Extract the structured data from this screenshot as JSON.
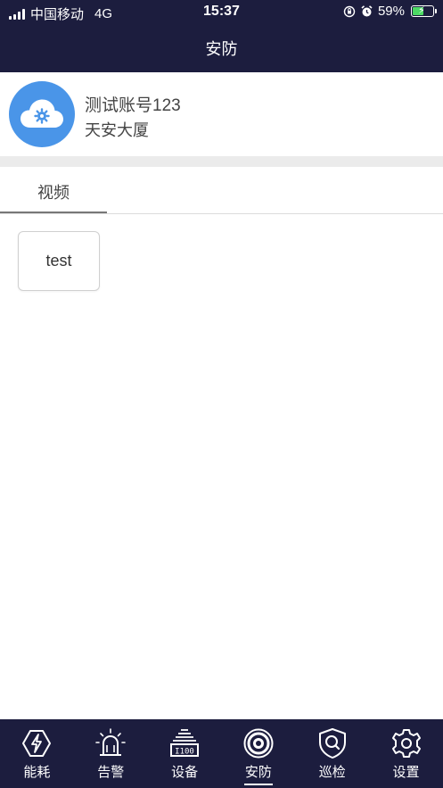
{
  "status_bar": {
    "carrier": "中国移动",
    "network": "4G",
    "time": "15:37",
    "battery": "59%",
    "battery_level": 0.59
  },
  "header": {
    "title": "安防"
  },
  "account": {
    "name": "测试账号123",
    "building": "天安大厦"
  },
  "tabs": [
    {
      "label": "视频",
      "active": true
    }
  ],
  "videos": [
    {
      "label": "test"
    }
  ],
  "bottom_nav": {
    "items": [
      {
        "label": "能耗",
        "icon": "lightning-shield-icon"
      },
      {
        "label": "告警",
        "icon": "alarm-light-icon"
      },
      {
        "label": "设备",
        "icon": "device-icon"
      },
      {
        "label": "安防",
        "icon": "security-camera-icon",
        "active": true
      },
      {
        "label": "巡检",
        "icon": "patrol-shield-icon"
      },
      {
        "label": "设置",
        "icon": "gear-icon"
      }
    ]
  },
  "colors": {
    "header_bg": "#1c1d3e",
    "avatar_bg": "#4a95e8",
    "battery_fill": "#4cd964"
  }
}
